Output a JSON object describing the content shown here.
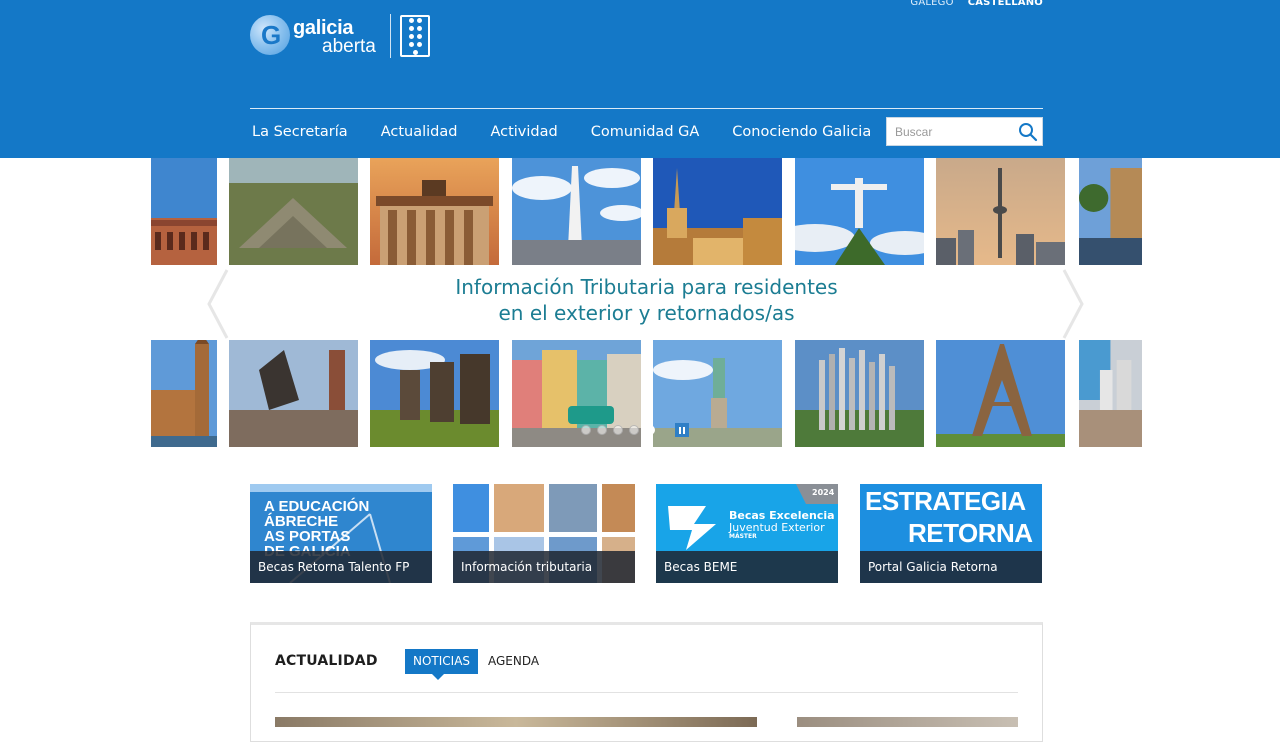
{
  "header": {
    "languages": [
      {
        "label": "GALEGO",
        "active": false
      },
      {
        "label": "CASTELLANO",
        "active": true
      }
    ],
    "logo": {
      "line1": "galicia",
      "line2": "aberta",
      "mark": "G"
    },
    "nav": [
      {
        "label": "La Secretaría"
      },
      {
        "label": "Actualidad"
      },
      {
        "label": "Actividad"
      },
      {
        "label": "Comunidad GA"
      },
      {
        "label": "Conociendo Galicia"
      }
    ],
    "search": {
      "placeholder": "Buscar",
      "icon": "search-icon"
    },
    "colors": {
      "brand": "#1478c7"
    }
  },
  "banner": {
    "headline_line1": "Información Tributaria para residentes",
    "headline_line2": "en el exterior y retornados/as",
    "slides_count": 5,
    "active_slide": 4,
    "text_color": "#1c7d93"
  },
  "cards": [
    {
      "caption": "Becas Retorna Talento FP",
      "image_text": "A EDUCACIÓN ÁBRECHE AS PORTAS DE GALICIA"
    },
    {
      "caption": "Información tributaria"
    },
    {
      "caption": "Becas BEME",
      "image_title": "Becas Excelencia",
      "image_subtitle": "Juventud Exterior",
      "image_tag": "MÁSTER",
      "year": "2024"
    },
    {
      "caption": "Portal Galicia Retorna",
      "image_line1": "ESTRATEGIA",
      "image_line2": "RETORNA"
    }
  ],
  "actualidad": {
    "title": "ACTUALIDAD",
    "tabs": [
      {
        "label": "NOTICIAS",
        "active": true
      },
      {
        "label": "AGENDA",
        "active": false
      }
    ]
  }
}
